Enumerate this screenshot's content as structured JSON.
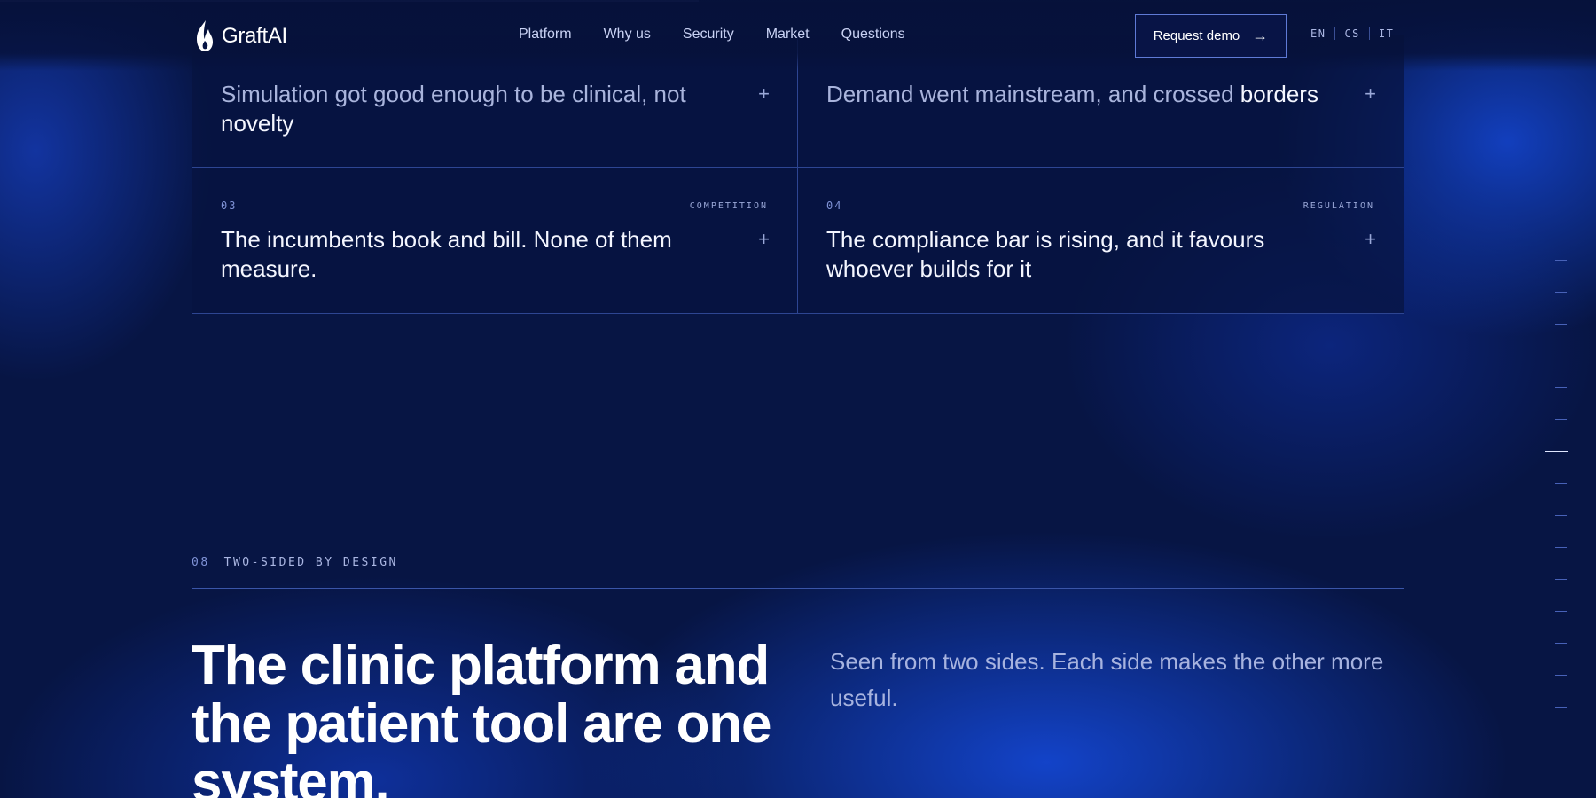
{
  "brand": {
    "name": "GraftAI"
  },
  "progress": {
    "percent": 43.8
  },
  "nav": {
    "items": [
      {
        "label": "Platform"
      },
      {
        "label": "Why us"
      },
      {
        "label": "Security"
      },
      {
        "label": "Market"
      },
      {
        "label": "Questions"
      }
    ]
  },
  "cta": {
    "label": "Request demo",
    "arrow": "→"
  },
  "languages": [
    "EN",
    "CS",
    "IT"
  ],
  "cards": [
    {
      "number": "",
      "tag": "",
      "title_dim": "Simulation got good enough to be clinical, not",
      "title_rest": "novelty",
      "expand": "+"
    },
    {
      "number": "",
      "tag": "",
      "title_dim": "Demand went mainstream, and crossed",
      "title_rest": "borders",
      "expand": "+"
    },
    {
      "number": "03",
      "tag": "COMPETITION",
      "title_dim": "",
      "title_rest": "The incumbents book and bill. None of them measure.",
      "expand": "+"
    },
    {
      "number": "04",
      "tag": "REGULATION",
      "title_dim": "",
      "title_rest": "The compliance bar is rising, and it favours whoever builds for it",
      "expand": "+"
    }
  ],
  "section": {
    "number": "08",
    "label": "TWO-SIDED BY DESIGN",
    "headline": "The clinic platform and the patient tool are one system.",
    "lead": "Seen from two sides. Each side makes the other more useful."
  },
  "scroll_indicator": {
    "count": 16,
    "active_index": 6
  },
  "colors": {
    "background": "#071544",
    "accent_glow": "#1446d7",
    "border": "#2d4592",
    "text": "#f4f6ff",
    "muted": "#a7b3df"
  }
}
